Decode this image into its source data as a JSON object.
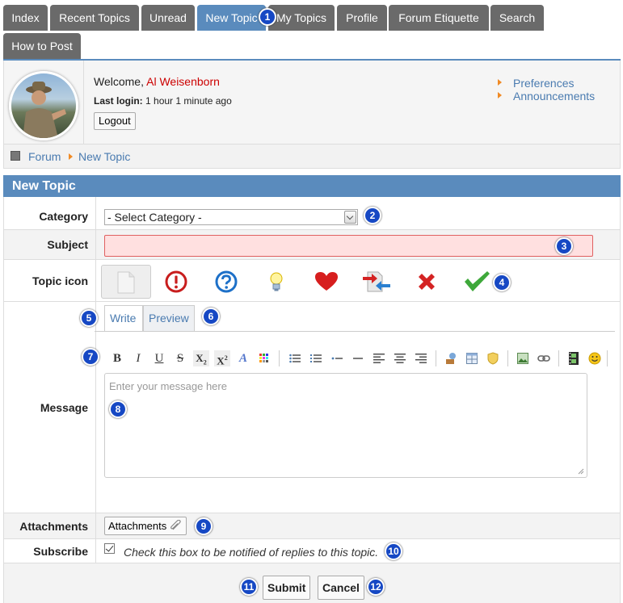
{
  "nav": {
    "tabs": [
      "Index",
      "Recent Topics",
      "Unread",
      "New Topic",
      "My Topics",
      "Profile",
      "Forum Etiquette",
      "Search",
      "How to Post"
    ],
    "active": "New Topic"
  },
  "user": {
    "welcome": "Welcome,",
    "name": "Al Weisenborn",
    "last_login_label": "Last login:",
    "last_login_value": "1 hour 1 minute ago",
    "logout_label": "Logout"
  },
  "links": {
    "preferences": "Preferences",
    "announcements": "Announcements"
  },
  "breadcrumb": {
    "root": "Forum",
    "current": "New Topic"
  },
  "form": {
    "title": "New Topic",
    "category_label": "Category",
    "category_value": "- Select Category -",
    "subject_label": "Subject",
    "topic_icon_label": "Topic icon",
    "message_label": "Message",
    "write_tab": "Write",
    "preview_tab": "Preview",
    "message_placeholder": "Enter your message here",
    "attachments_label": "Attachments",
    "attachments_button": "Attachments",
    "subscribe_label": "Subscribe",
    "subscribe_text": "Check this box to be notified of replies to this topic.",
    "submit": "Submit",
    "cancel": "Cancel"
  },
  "badges": [
    "1",
    "2",
    "3",
    "4",
    "5",
    "6",
    "7",
    "8",
    "9",
    "10",
    "11",
    "12"
  ],
  "colors": {
    "accent": "#5a8bbd",
    "tab": "#6a6a6a",
    "badge": "#1648c4",
    "link": "#4a7bb0",
    "username": "#cc0000"
  }
}
